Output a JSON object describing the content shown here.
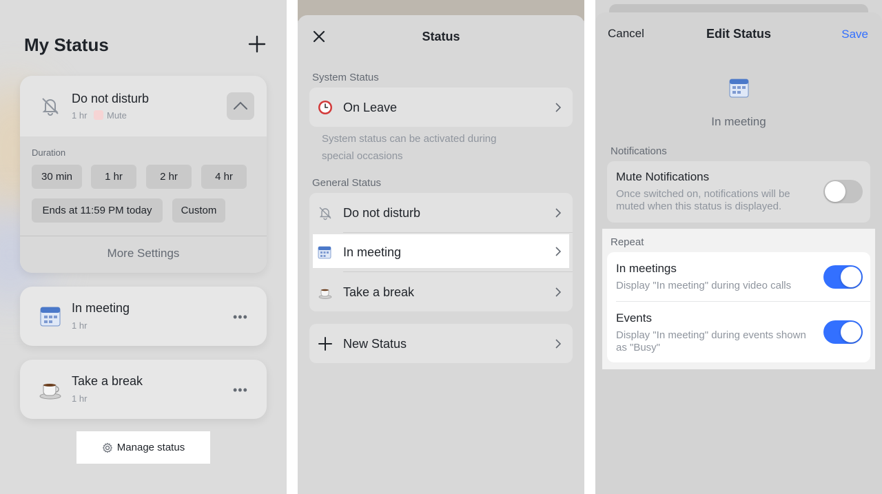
{
  "my_status": {
    "title": "My Status",
    "dnd": {
      "name": "Do not disturb",
      "duration": "1 hr",
      "mute_label": "Mute",
      "duration_label": "Duration",
      "chips": [
        "30 min",
        "1 hr",
        "2 hr",
        "4 hr",
        "Ends at 11:59 PM today",
        "Custom"
      ],
      "more_settings": "More Settings"
    },
    "items": [
      {
        "name": "In meeting",
        "duration": "1 hr",
        "icon": "calendar-icon"
      },
      {
        "name": "Take a break",
        "duration": "1 hr",
        "icon": "coffee-icon"
      }
    ],
    "manage_label": "Manage status"
  },
  "status_panel": {
    "title": "Status",
    "system_label": "System Status",
    "system_items": [
      {
        "label": "On Leave",
        "icon": "clock-icon"
      }
    ],
    "system_hint": "System status can be activated during special occasions",
    "general_label": "General Status",
    "general_items": [
      {
        "label": "Do not disturb",
        "icon": "bell-off-icon"
      },
      {
        "label": "In meeting",
        "icon": "calendar-icon"
      },
      {
        "label": "Take a break",
        "icon": "coffee-icon"
      }
    ],
    "new_status": "New Status"
  },
  "edit_status": {
    "cancel": "Cancel",
    "title": "Edit Status",
    "save": "Save",
    "status_name": "In meeting",
    "notifications_label": "Notifications",
    "mute": {
      "title": "Mute Notifications",
      "desc": "Once switched on, notifications will be muted when this status is displayed.",
      "enabled": false
    },
    "repeat_label": "Repeat",
    "repeat_items": [
      {
        "title": "In meetings",
        "desc": "Display \"In meeting\" during video calls",
        "enabled": true
      },
      {
        "title": "Events",
        "desc": "Display \"In meeting\" during events shown as \"Busy\"",
        "enabled": true
      }
    ]
  },
  "colors": {
    "accent": "#3370ff",
    "toggle_off": "#c3c3c3"
  }
}
